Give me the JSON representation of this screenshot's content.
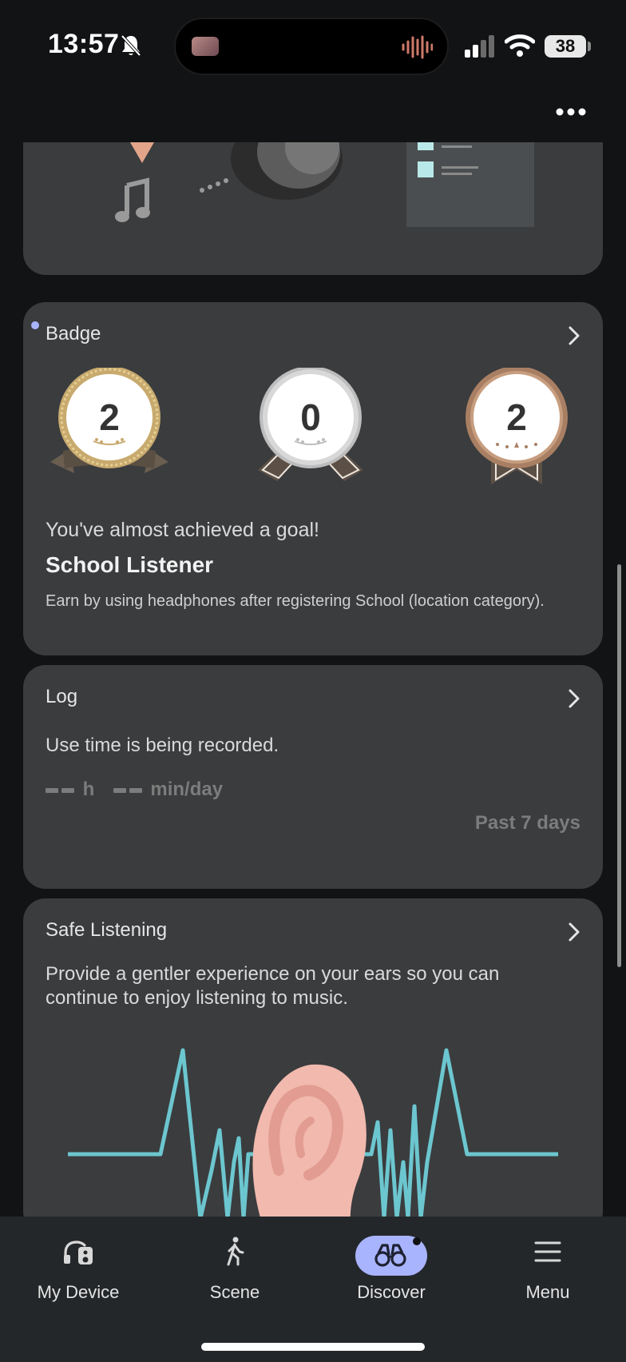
{
  "status_bar": {
    "time": "13:57",
    "battery": "38",
    "icons": [
      "bell-slash-icon",
      "cellular-signal-icon",
      "wifi-icon",
      "battery-icon"
    ]
  },
  "header": {
    "more_icon": "more-horizontal-icon"
  },
  "badge_card": {
    "title": "Badge",
    "badges": [
      {
        "count": "2",
        "tier": "gold",
        "color": "#c8aa6e"
      },
      {
        "count": "0",
        "tier": "silver",
        "color": "#bdbdbd"
      },
      {
        "count": "2",
        "tier": "bronze",
        "color": "#a97f63"
      }
    ],
    "goal_message": "You've almost achieved a goal!",
    "goal_name": "School Listener",
    "goal_description": "Earn by using headphones after registering School (location category)."
  },
  "log_card": {
    "title": "Log",
    "message": "Use time is being recorded.",
    "hour_unit": "h",
    "minute_unit": "min/day",
    "period": "Past 7 days"
  },
  "safe_listening_card": {
    "title": "Safe Listening",
    "description": "Provide a gentler experience on your ears so you can continue to enjoy listening to music."
  },
  "bottom_nav": {
    "items": [
      {
        "label": "My Device",
        "icon": "headphones-device-icon",
        "active": false
      },
      {
        "label": "Scene",
        "icon": "walking-person-icon",
        "active": false
      },
      {
        "label": "Discover",
        "icon": "binoculars-icon",
        "active": true
      },
      {
        "label": "Menu",
        "icon": "hamburger-menu-icon",
        "active": false
      }
    ]
  },
  "colors": {
    "background": "#111314",
    "card": "#3a3c3e",
    "accent": "#a9b4ff",
    "waveform": "#6cc6cf",
    "ear": "#f2b9ae"
  }
}
